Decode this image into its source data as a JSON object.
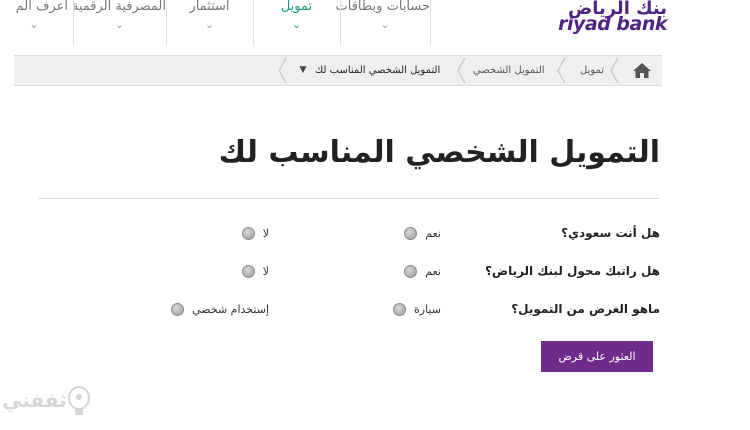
{
  "brand": {
    "name_ar": "بنك الرياض",
    "name_en": "riyad bank",
    "color": "#4f2683"
  },
  "nav": {
    "items": [
      {
        "label": "حسابات وبطاقات",
        "active": false
      },
      {
        "label": "تمويل",
        "active": true
      },
      {
        "label": "استثمار",
        "active": false
      },
      {
        "label": "المصرفية الرقمية",
        "active": false
      },
      {
        "label": "اعرف الم",
        "active": false
      }
    ],
    "active_color": "#1a9a7c"
  },
  "breadcrumb": {
    "items": [
      "تمويل",
      "التمويل الشخصي",
      "التمويل الشخصي المناسب لك"
    ],
    "home_icon": "home-icon",
    "dropdown_icon": "caret-down-icon",
    "dropdown_glyph": "▼"
  },
  "page": {
    "title": "التمويل الشخصي المناسب لك"
  },
  "questions": [
    {
      "label": "هل أنت سعودي؟",
      "options": [
        "نعم",
        "لا"
      ]
    },
    {
      "label": "هل راتبك محول لبنك الرياض؟",
      "options": [
        "نعم",
        "لا"
      ]
    },
    {
      "label": "ماهو الغرض من التمويل؟",
      "options": [
        "سيارة",
        "إستخدام شخصي"
      ]
    }
  ],
  "submit": {
    "label": "العثور على قرض",
    "color": "#6d2c8a"
  },
  "watermark": {
    "text": "ثقفني"
  }
}
